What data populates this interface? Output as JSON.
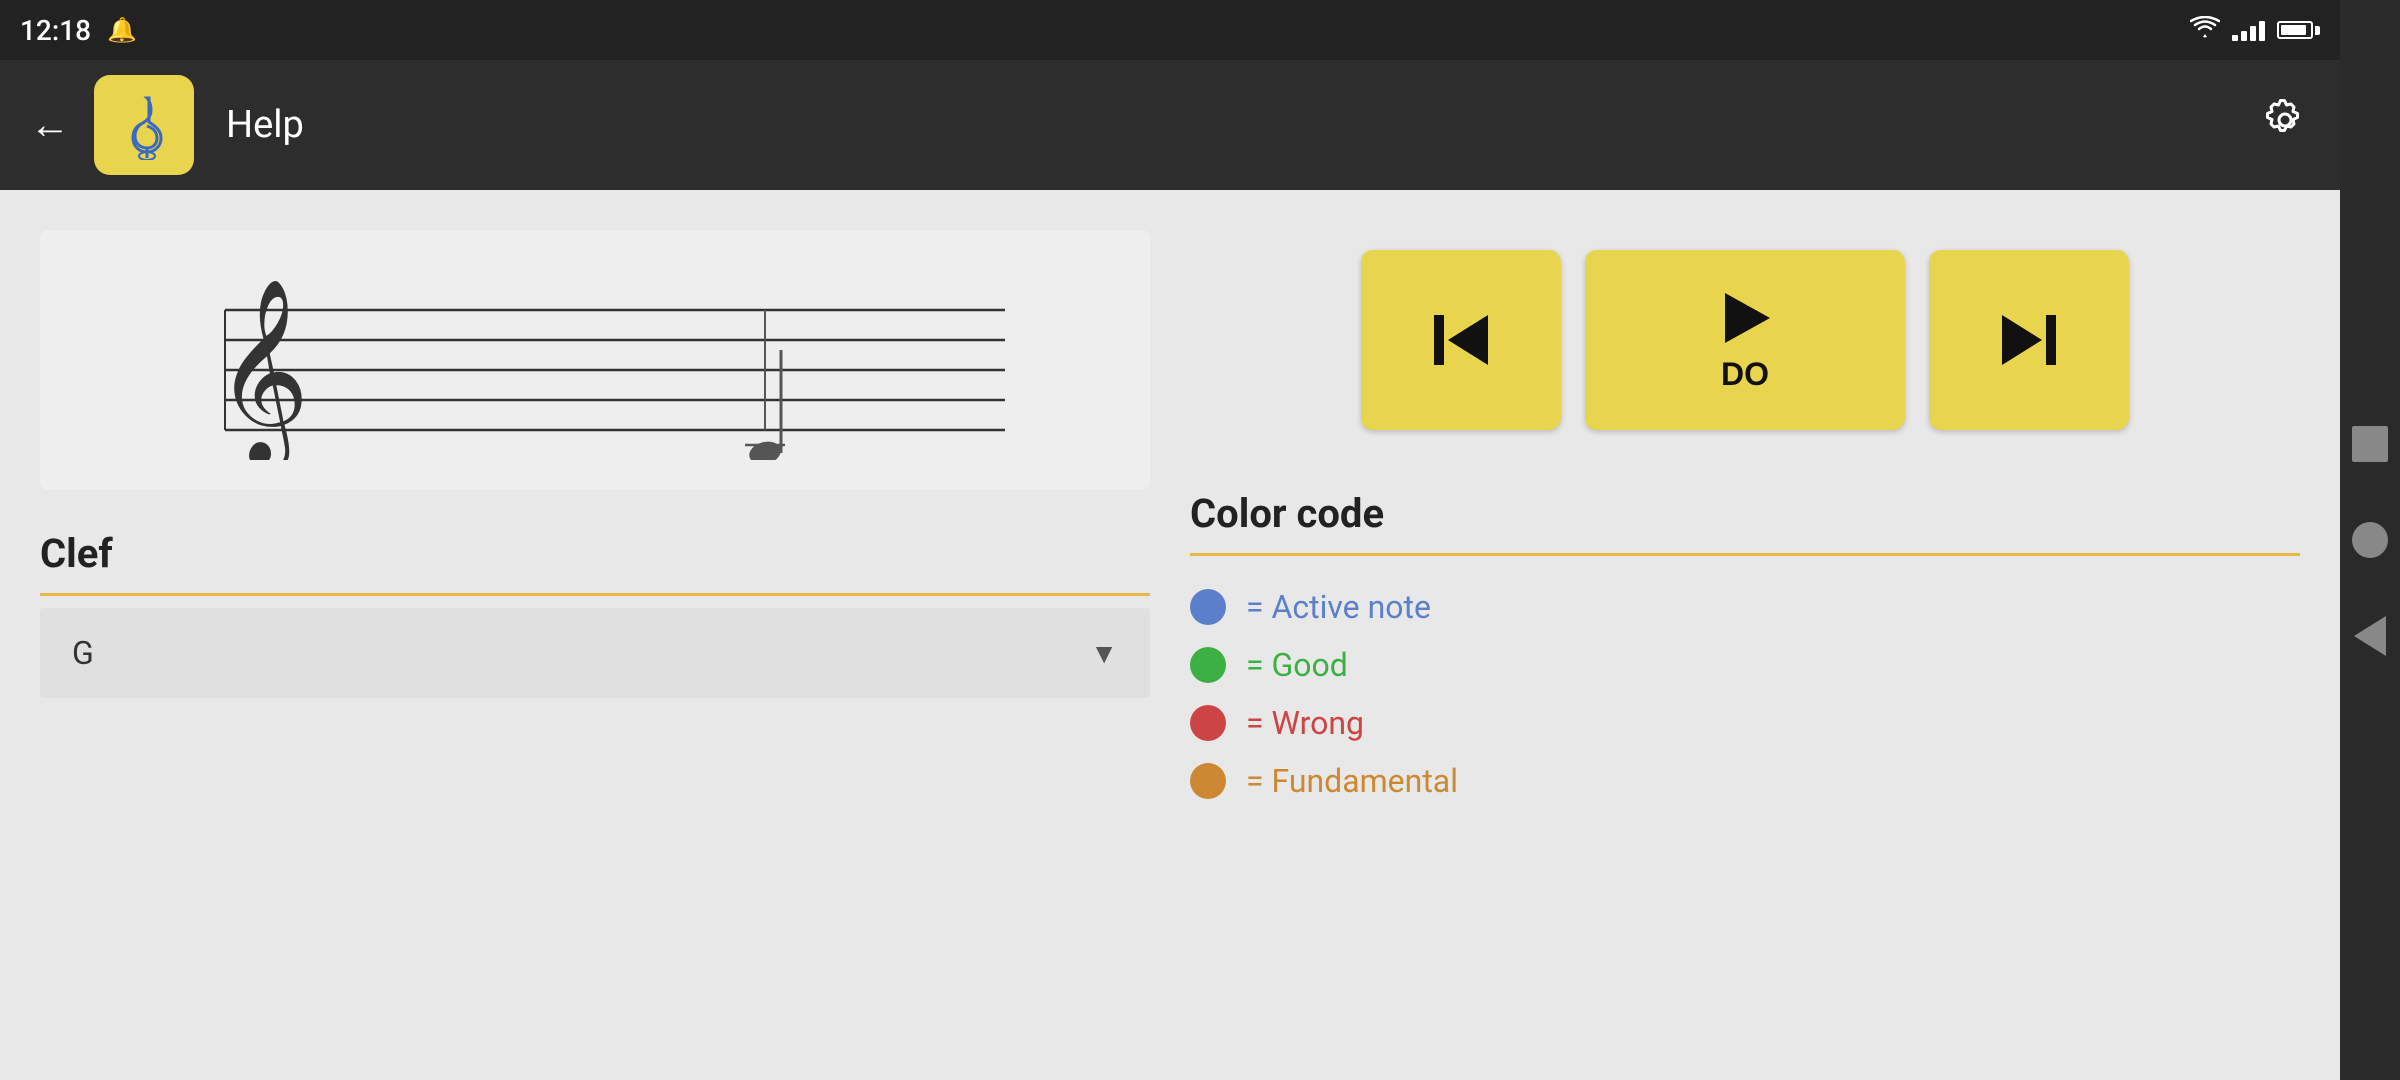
{
  "statusBar": {
    "time": "12:18",
    "wifiLabel": "wifi",
    "signalLabel": "signal",
    "batteryLabel": "battery"
  },
  "appBar": {
    "backLabel": "←",
    "title": "Help",
    "settingsLabel": "⚙"
  },
  "staff": {
    "clefType": "treble"
  },
  "clef": {
    "sectionTitle": "Clef",
    "value": "G",
    "dropdownArrow": "▼"
  },
  "playback": {
    "prevLabel": "⏮",
    "playLabel": "▶",
    "noteLabel": "DO",
    "nextLabel": "⏭"
  },
  "colorCode": {
    "sectionTitle": "Color code",
    "items": [
      {
        "color": "blue",
        "text": "= Active note"
      },
      {
        "color": "green",
        "text": "= Good"
      },
      {
        "color": "red",
        "text": "= Wrong"
      },
      {
        "color": "orange",
        "text": "= Fundamental"
      }
    ]
  }
}
